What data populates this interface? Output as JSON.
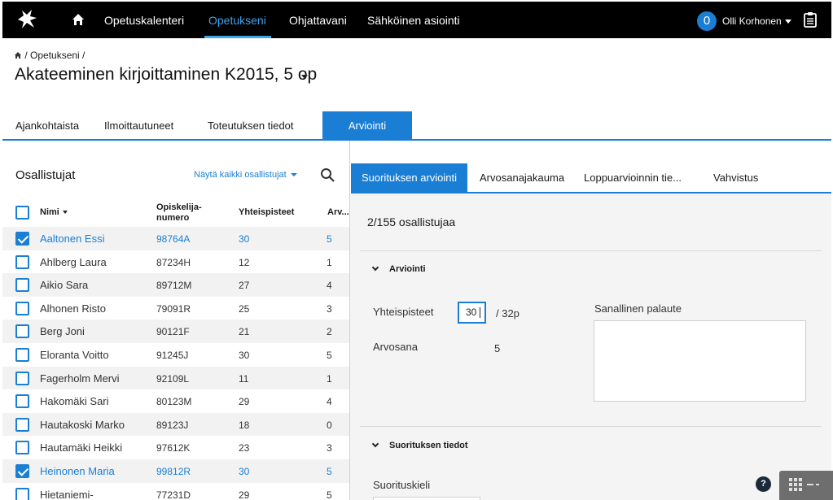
{
  "nav": {
    "items": [
      "Opetuskalenteri",
      "Opetukseni",
      "Ohjattavani",
      "Sähköinen asiointi"
    ],
    "notification_count": "0",
    "user_name": "Olli Korhonen"
  },
  "breadcrumb": {
    "item": "Opetukseni"
  },
  "page": {
    "title": "Akateeminen kirjoittaminen K2015, 5 op"
  },
  "tabs": [
    "Ajankohtaista",
    "Ilmoittautuneet",
    "Toteutuksen tiedot",
    "Arviointi"
  ],
  "participants": {
    "title": "Osallistujat",
    "filter_label": "Näytä kaikki osallistujat",
    "columns": {
      "name": "Nimi",
      "student_number_line1": "Opiskelija-",
      "student_number_line2": "numero",
      "total_points": "Yhteispisteet",
      "grade": "Arv..."
    },
    "rows": [
      {
        "name": "Aaltonen Essi",
        "number": "98764A",
        "points": "30",
        "grade": "5",
        "checked": true
      },
      {
        "name": "Ahlberg Laura",
        "number": "87234H",
        "points": "12",
        "grade": "1",
        "checked": false
      },
      {
        "name": "Aikio Sara",
        "number": "89712M",
        "points": "27",
        "grade": "4",
        "checked": false
      },
      {
        "name": "Alhonen Risto",
        "number": "79091R",
        "points": "25",
        "grade": "3",
        "checked": false
      },
      {
        "name": "Berg Joni",
        "number": "90121F",
        "points": "21",
        "grade": "2",
        "checked": false
      },
      {
        "name": "Eloranta Voitto",
        "number": "91245J",
        "points": "30",
        "grade": "5",
        "checked": false
      },
      {
        "name": "Fagerholm Mervi",
        "number": "92109L",
        "points": "11",
        "grade": "1",
        "checked": false
      },
      {
        "name": "Hakomäki Sari",
        "number": "80123M",
        "points": "29",
        "grade": "4",
        "checked": false
      },
      {
        "name": "Hautakoski Marko",
        "number": "89123J",
        "points": "18",
        "grade": "0",
        "checked": false
      },
      {
        "name": "Hautamäki Heikki",
        "number": "97612K",
        "points": "23",
        "grade": "3",
        "checked": false
      },
      {
        "name": "Heinonen Maria",
        "number": "99812R",
        "points": "30",
        "grade": "5",
        "checked": true
      },
      {
        "name": "Hietaniemi-",
        "number": "77231D",
        "points": "29",
        "grade": "5",
        "checked": false
      }
    ]
  },
  "assessment": {
    "subtabs": [
      "Suorituksen arviointi",
      "Arvosanajakauma",
      "Loppuarvioinnin tie...",
      "Vahvistus"
    ],
    "selected_count": "2/155 osallistujaa",
    "section_grading": "Arviointi",
    "total_points_label": "Yhteispisteet",
    "total_points_value": "30",
    "max_points": "/ 32p",
    "grade_label": "Arvosana",
    "grade_value": "5",
    "feedback_label": "Sanallinen palaute",
    "section_details": "Suorituksen tiedot",
    "language_label": "Suorituskieli",
    "help_label": "?"
  },
  "colors": {
    "accent": "#1a7fd4",
    "topbar": "#000000"
  }
}
